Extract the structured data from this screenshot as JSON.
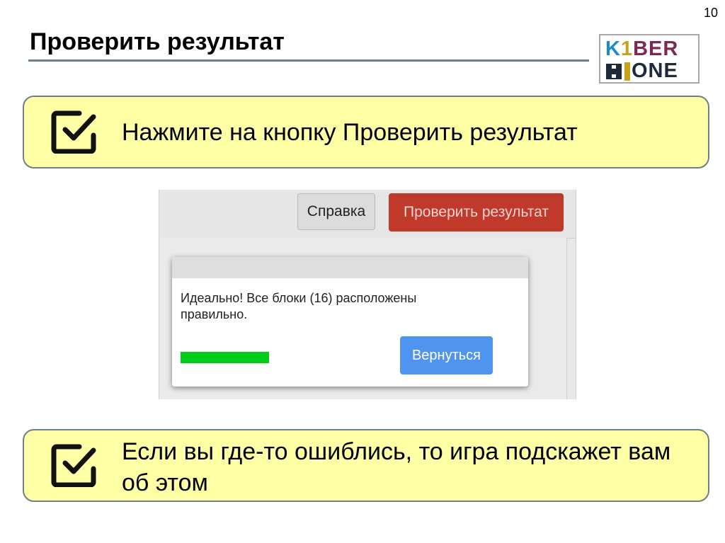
{
  "slide": {
    "number": "10",
    "title": "Проверить результат"
  },
  "logo": {
    "line1_k": "K",
    "line1_one": "1",
    "line1_ber": "BER",
    "line2": "ONE"
  },
  "callouts": [
    {
      "text": "Нажмите на кнопку Проверить результат",
      "icon": "checkbox-icon"
    },
    {
      "text": "Если вы где-то ошиблись, то игра подскажет вам об этом",
      "icon": "checkbox-icon"
    }
  ],
  "screenshot": {
    "toolbar": {
      "help_label": "Справка",
      "check_label": "Проверить результат"
    },
    "dialog": {
      "message": "Идеально! Все блоки (16) расположены правильно.",
      "return_label": "Вернуться",
      "progress": 1.0
    }
  },
  "colors": {
    "callout_bg": "#ffffa6",
    "check_button": "#c0392b",
    "return_button": "#4f95f0",
    "progress": "#00cc1a"
  }
}
